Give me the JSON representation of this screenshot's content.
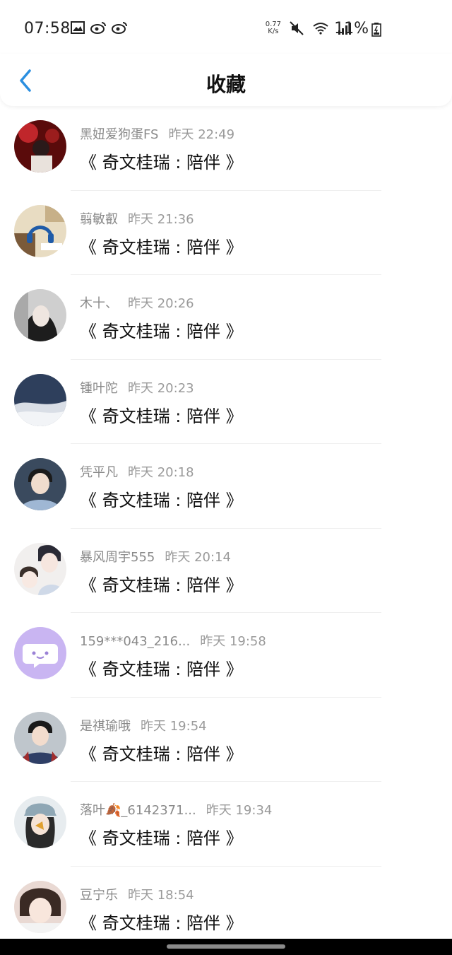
{
  "status": {
    "time": "07:58",
    "net_speed_value": "0.77",
    "net_speed_unit": "K/s",
    "battery": "11%"
  },
  "header": {
    "title": "收藏"
  },
  "items": [
    {
      "user": "黑妞爱狗蛋FS",
      "time": "昨天 22:49",
      "content": "《 奇文桂瑞 : 陪伴 》",
      "avatar": "dark-red-photo"
    },
    {
      "user": "翦敏叡",
      "time": "昨天 21:36",
      "content": "《 奇文桂瑞 : 陪伴 》",
      "avatar": "headphones-cartoon"
    },
    {
      "user": "木十、",
      "time": "昨天 20:26",
      "content": "《 奇文桂瑞 : 陪伴 》",
      "avatar": "girl-photo"
    },
    {
      "user": "锺叶陀",
      "time": "昨天 20:23",
      "content": "《 奇文桂瑞 : 陪伴 》",
      "avatar": "sky-photo"
    },
    {
      "user": "凭平凡",
      "time": "昨天 20:18",
      "content": "《 奇文桂瑞 : 陪伴 》",
      "avatar": "boy-photo"
    },
    {
      "user": "暴风周宇555",
      "time": "昨天 20:14",
      "content": "《 奇文桂瑞 : 陪伴 》",
      "avatar": "anime-couple"
    },
    {
      "user": "159***043_216...",
      "time": "昨天 19:58",
      "content": "《 奇文桂瑞 : 陪伴 》",
      "avatar": "default-chat"
    },
    {
      "user": "是祺瑜哦",
      "time": "昨天 19:54",
      "content": "《 奇文桂瑞 : 陪伴 》",
      "avatar": "boy-plaid-photo"
    },
    {
      "user": "落叶🍂_6142371...",
      "time": "昨天 19:34",
      "content": "《 奇文桂瑞 : 陪伴 》",
      "avatar": "girl-hat-photo"
    },
    {
      "user": "豆宁乐",
      "time": "昨天 18:54",
      "content": "《 奇文桂瑞 : 陪伴 》",
      "avatar": "girl-closeup-photo"
    }
  ]
}
